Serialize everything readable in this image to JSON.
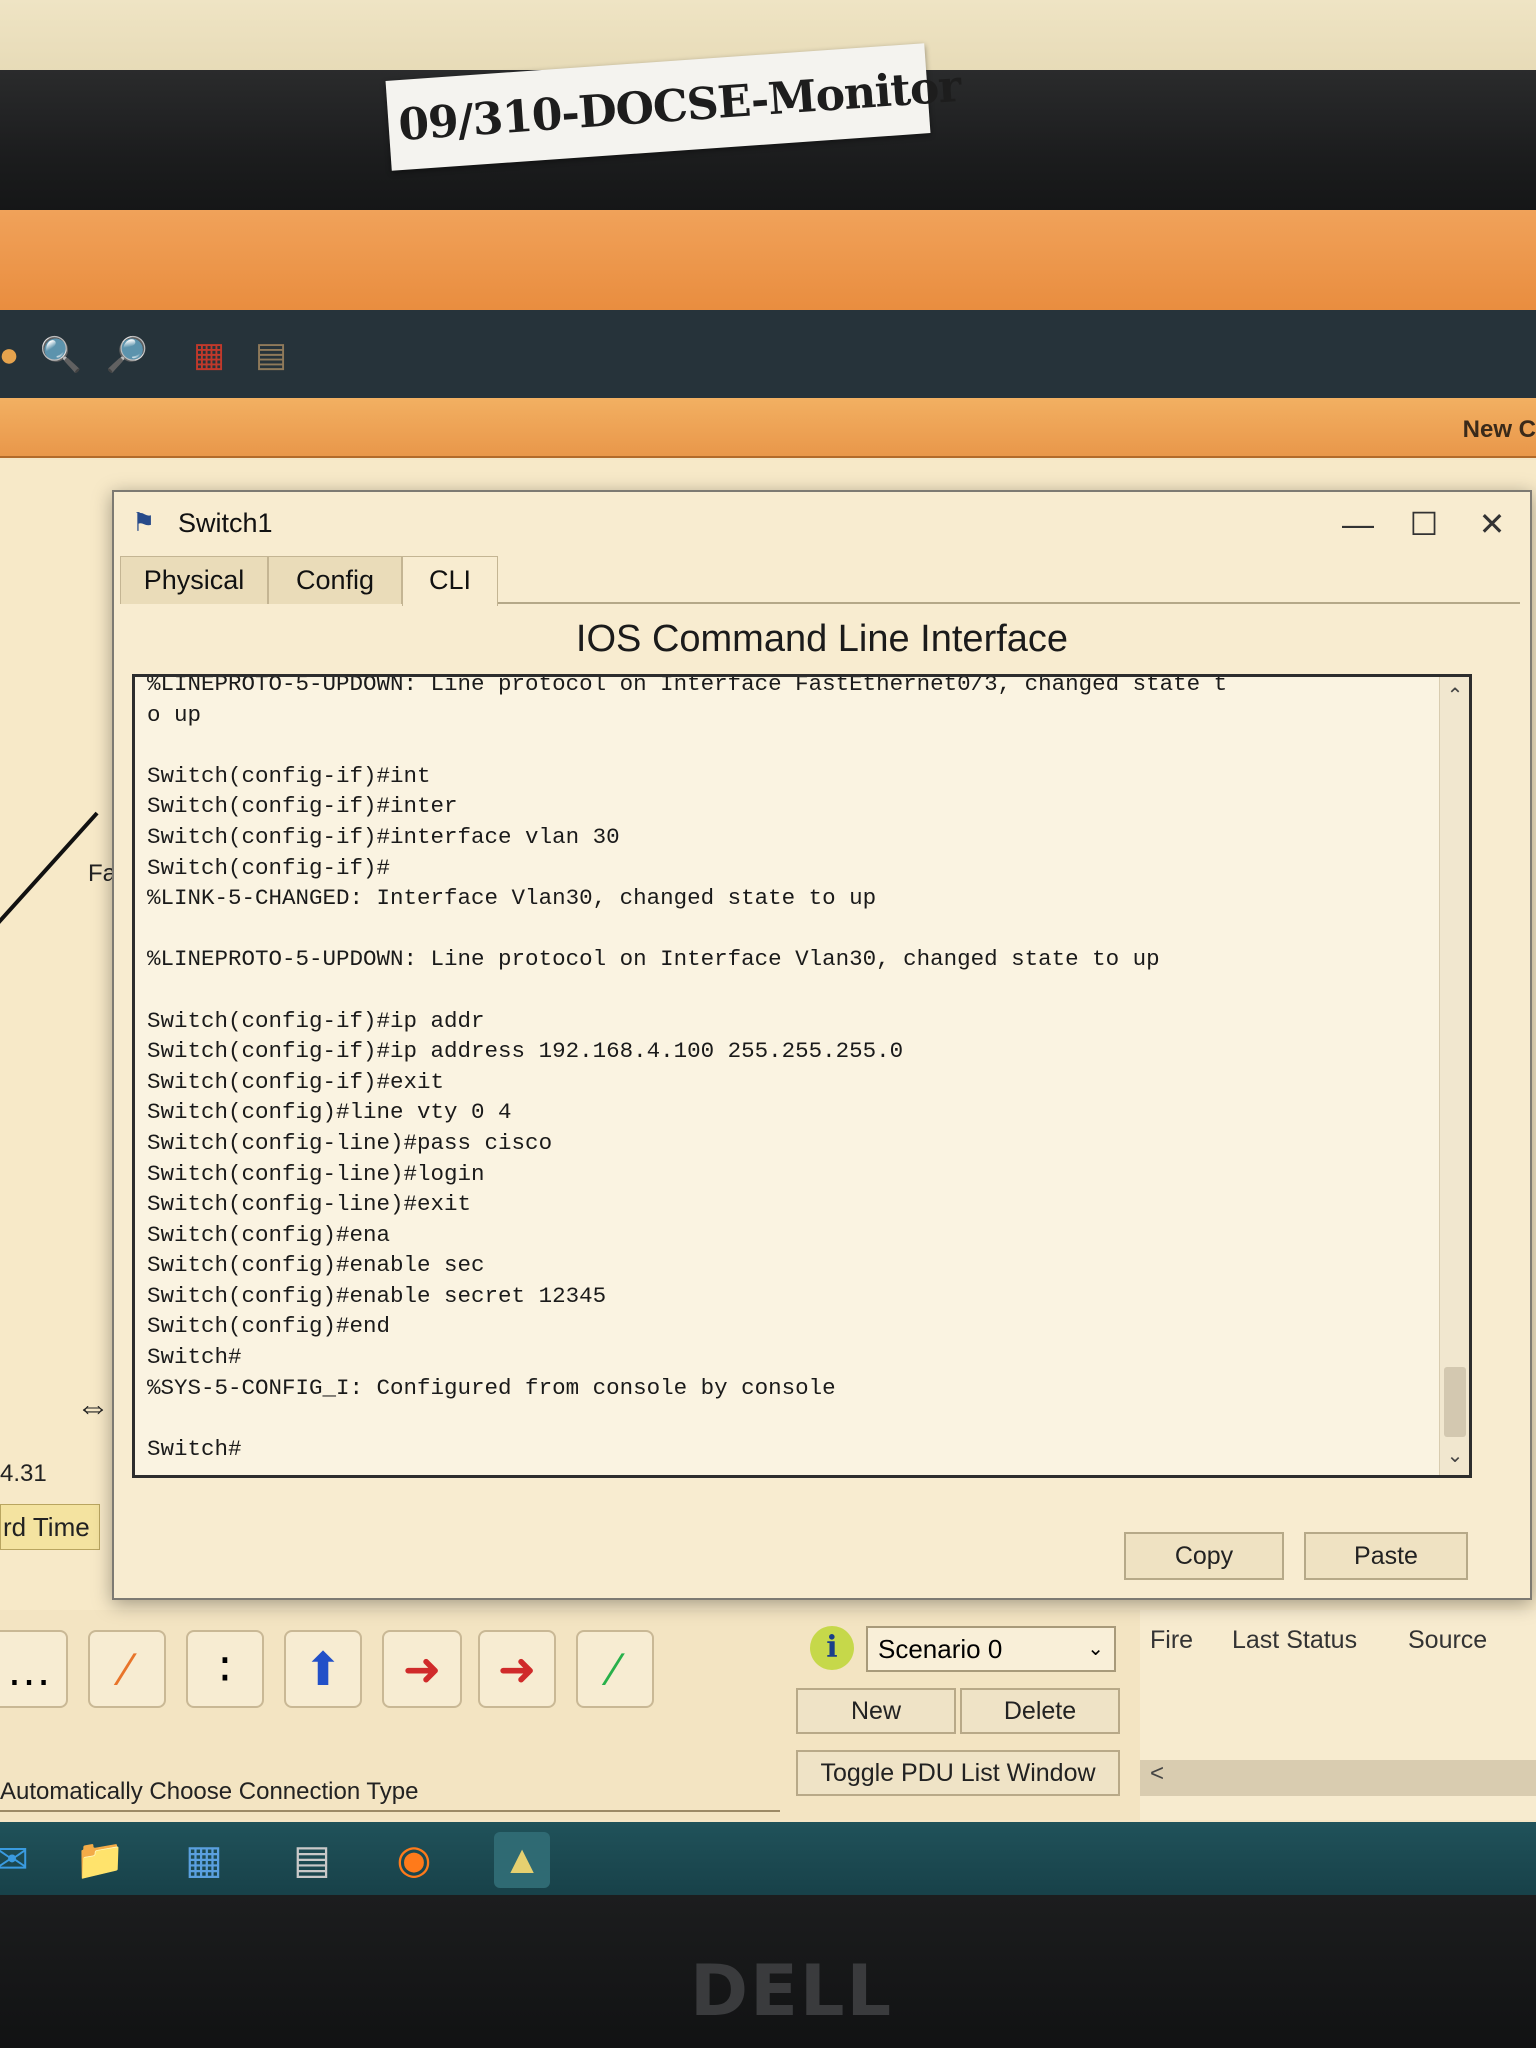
{
  "monitor": {
    "asset_label": "09/310-DOCSE-Monitor",
    "brand": "DELL"
  },
  "app": {
    "toolbar_icons": [
      "zoom-in-icon",
      "zoom-out-icon",
      "palette-icon",
      "custom-device-icon"
    ],
    "cluster_label": "New C"
  },
  "workspace": {
    "interface_label": "Fa",
    "ip_fragment": "4.31",
    "realtime_label": "rd Time"
  },
  "dialog": {
    "title": "Switch1",
    "tabs": [
      {
        "label": "Physical",
        "active": false
      },
      {
        "label": "Config",
        "active": false
      },
      {
        "label": "CLI",
        "active": true
      }
    ],
    "heading": "IOS Command Line Interface",
    "terminal_lines": [
      "%LINEPROTO-5-UPDOWN: Line protocol on Interface FastEthernet0/3, changed state t",
      "o up",
      "",
      "Switch(config-if)#int",
      "Switch(config-if)#inter",
      "Switch(config-if)#interface vlan 30",
      "Switch(config-if)#",
      "%LINK-5-CHANGED: Interface Vlan30, changed state to up",
      "",
      "%LINEPROTO-5-UPDOWN: Line protocol on Interface Vlan30, changed state to up",
      "",
      "Switch(config-if)#ip addr",
      "Switch(config-if)#ip address 192.168.4.100 255.255.255.0",
      "Switch(config-if)#exit",
      "Switch(config)#line vty 0 4",
      "Switch(config-line)#pass cisco",
      "Switch(config-line)#login",
      "Switch(config-line)#exit",
      "Switch(config)#ena",
      "Switch(config)#enable sec",
      "Switch(config)#enable secret 12345",
      "Switch(config)#end",
      "Switch#",
      "%SYS-5-CONFIG_I: Configured from console by console",
      "",
      "Switch#"
    ],
    "copy_label": "Copy",
    "paste_label": "Paste"
  },
  "bottom": {
    "connection_type_label": "Automatically Choose Connection Type",
    "scenario_value": "Scenario 0",
    "new_label": "New",
    "delete_label": "Delete",
    "toggle_pdu_label": "Toggle PDU List Window",
    "pdu_columns": [
      "Fire",
      "Last Status",
      "Source"
    ]
  },
  "taskbar": {
    "icons": [
      "mail-icon",
      "file-explorer-icon",
      "store-icon",
      "calculator-icon",
      "firefox-icon",
      "packet-tracer-icon"
    ]
  }
}
